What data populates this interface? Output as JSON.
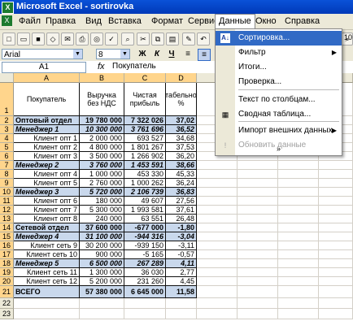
{
  "window": {
    "title": "Microsoft Excel - sortirovka",
    "app_icon": "X"
  },
  "menu": [
    "Файл",
    "Правка",
    "Вид",
    "Вставка",
    "Формат",
    "Сервис",
    "Данные",
    "Окно",
    "Справка"
  ],
  "toolbar": {
    "zoom": "10"
  },
  "format_bar": {
    "font": "Arial",
    "size": "8",
    "bold": "Ж",
    "italic": "К",
    "underline": "Ч"
  },
  "formula_bar": {
    "name_box": "A1",
    "fx": "fx",
    "value": "Покупатель"
  },
  "columns": [
    "A",
    "B",
    "C",
    "D"
  ],
  "header": {
    "row_num": "1",
    "cells": [
      "Покупатель",
      "Выручка без НДС",
      "Чистая прибыль",
      "Рентабельность, %"
    ]
  },
  "rows": [
    {
      "n": "2",
      "name": "Оптовый отдел",
      "rev": "19 780 000",
      "profit": "7 322 026",
      "pct": "37,02",
      "kind": "dept"
    },
    {
      "n": "3",
      "name": "Менеджер 1",
      "rev": "10 300 000",
      "profit": "3 761 696",
      "pct": "36,52",
      "kind": "mgr"
    },
    {
      "n": "4",
      "name": "Клиент опт 1",
      "rev": "2 000 000",
      "profit": "693 527",
      "pct": "34,68",
      "kind": "client"
    },
    {
      "n": "5",
      "name": "Клиент опт 2",
      "rev": "4 800 000",
      "profit": "1 801 267",
      "pct": "37,53",
      "kind": "client"
    },
    {
      "n": "6",
      "name": "Клиент опт 3",
      "rev": "3 500 000",
      "profit": "1 266 902",
      "pct": "36,20",
      "kind": "client"
    },
    {
      "n": "7",
      "name": "Менеджер 2",
      "rev": "3 760 000",
      "profit": "1 453 591",
      "pct": "38,66",
      "kind": "mgr"
    },
    {
      "n": "8",
      "name": "Клиент опт 4",
      "rev": "1 000 000",
      "profit": "453 330",
      "pct": "45,33",
      "kind": "client"
    },
    {
      "n": "9",
      "name": "Клиент опт 5",
      "rev": "2 760 000",
      "profit": "1 000 262",
      "pct": "36,24",
      "kind": "client"
    },
    {
      "n": "10",
      "name": "Менеджер 3",
      "rev": "5 720 000",
      "profit": "2 106 739",
      "pct": "36,83",
      "kind": "mgr"
    },
    {
      "n": "11",
      "name": "Клиент опт 6",
      "rev": "180 000",
      "profit": "49 607",
      "pct": "27,56",
      "kind": "client"
    },
    {
      "n": "12",
      "name": "Клиент опт 7",
      "rev": "5 300 000",
      "profit": "1 993 581",
      "pct": "37,61",
      "kind": "client"
    },
    {
      "n": "13",
      "name": "Клиент опт 8",
      "rev": "240 000",
      "profit": "63 551",
      "pct": "26,48",
      "kind": "client"
    },
    {
      "n": "14",
      "name": "Сетевой отдел",
      "rev": "37 600 000",
      "profit": "-677 000",
      "pct": "-1,80",
      "kind": "dept"
    },
    {
      "n": "15",
      "name": "Менеджер 4",
      "rev": "31 100 000",
      "profit": "-944 316",
      "pct": "-3,04",
      "kind": "mgr"
    },
    {
      "n": "16",
      "name": "Клиент сеть 9",
      "rev": "30 200 000",
      "profit": "-939 150",
      "pct": "-3,11",
      "kind": "client"
    },
    {
      "n": "17",
      "name": "Клиент сеть 10",
      "rev": "900 000",
      "profit": "-5 165",
      "pct": "-0,57",
      "kind": "client"
    },
    {
      "n": "18",
      "name": "Менеджер 5",
      "rev": "6 500 000",
      "profit": "267 289",
      "pct": "4,11",
      "kind": "mgr"
    },
    {
      "n": "19",
      "name": "Клиент сеть 11",
      "rev": "1 300 000",
      "profit": "36 030",
      "pct": "2,77",
      "kind": "client"
    },
    {
      "n": "20",
      "name": "Клиент сеть 12",
      "rev": "5 200 000",
      "profit": "231 260",
      "pct": "4,45",
      "kind": "client"
    }
  ],
  "total": {
    "n": "21",
    "name": "ВСЕГО",
    "rev": "57 380 000",
    "profit": "6 645 000",
    "pct": "11,58"
  },
  "extra_rows": [
    "22",
    "23"
  ],
  "data_menu": {
    "items": [
      {
        "label": "Сортировка...",
        "icon": "sort-icon",
        "glyph": "A↓",
        "submenu": false
      },
      {
        "label": "Фильтр",
        "icon": "",
        "glyph": "",
        "submenu": true
      },
      {
        "label": "Итоги...",
        "icon": "",
        "glyph": "",
        "submenu": false
      },
      {
        "label": "Проверка...",
        "icon": "",
        "glyph": "",
        "submenu": false
      },
      {
        "label": "Текст по столбцам...",
        "icon": "",
        "glyph": "",
        "submenu": false
      },
      {
        "label": "Сводная таблица...",
        "icon": "pivot-icon",
        "glyph": "▦",
        "submenu": false
      },
      {
        "label": "Импорт внешних данных",
        "icon": "",
        "glyph": "",
        "submenu": true
      },
      {
        "label": "Обновить данные",
        "icon": "refresh-icon",
        "glyph": "!",
        "submenu": false
      }
    ],
    "more": "»"
  }
}
